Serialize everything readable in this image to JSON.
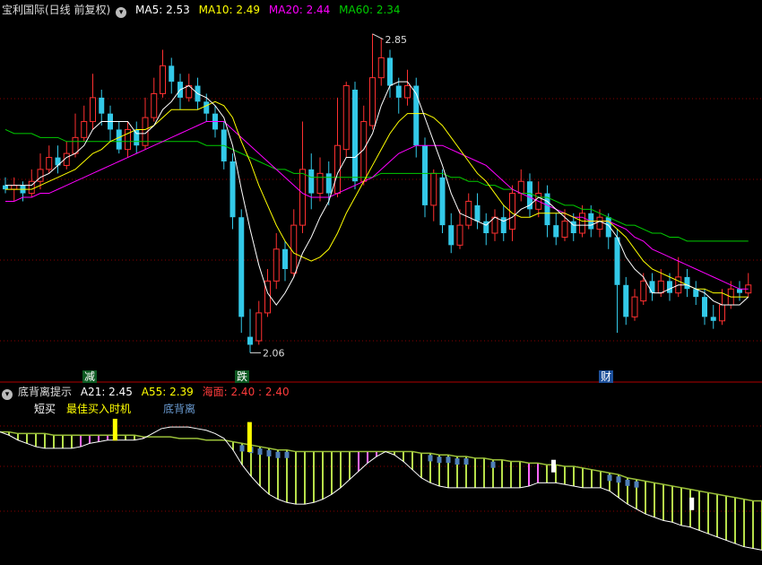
{
  "main_header": {
    "title": "宝利国际(日线 前复权)",
    "ma": [
      {
        "label": "MA5:",
        "value": "2.53",
        "color": "#ffffff"
      },
      {
        "label": "MA10:",
        "value": "2.49",
        "color": "#ffff00"
      },
      {
        "label": "MA20:",
        "value": "2.44",
        "color": "#ff00ff"
      },
      {
        "label": "MA60:",
        "value": "2.34",
        "color": "#00ff00"
      }
    ]
  },
  "sub_header": {
    "title": "底背离提示",
    "items": [
      {
        "text": "A21: 2.45",
        "color": "#ffffff"
      },
      {
        "text": "A55: 2.39",
        "color": "#ffff00"
      },
      {
        "text": "海面: 2.40 : 2.40",
        "color": "#ff3b3b"
      }
    ]
  },
  "signal_legend": [
    {
      "text": "短买",
      "color": "#ffffff"
    },
    {
      "text": "最佳买入时机",
      "color": "#ffff00"
    },
    {
      "text": "底背离",
      "color": "#6a9bd1"
    }
  ],
  "event_tags": [
    {
      "text": "减",
      "color": "#2e9e4a"
    },
    {
      "text": "跌",
      "color": "#2e9e4a"
    },
    {
      "text": "财",
      "color": "#3a7bd5"
    }
  ],
  "colors": {
    "up": "#ff3030",
    "down": "#33c9e8",
    "ma5": "#ffffff",
    "ma10": "#ffff00",
    "ma20": "#ff00ff",
    "ma60": "#00cc00",
    "grid": "#8a0000",
    "osc_bar": "#b6df4a",
    "osc_env": "#9abf3a",
    "osc_pink": "#ff66ff",
    "osc_blue": "#4f7fb8"
  },
  "chart_data": {
    "type": "candlestick",
    "ylim": [
      2.0,
      2.9
    ],
    "annotations": {
      "high_label": "2.85",
      "low_label": "2.06"
    },
    "candles": [
      [
        2.48,
        2.47,
        2.5,
        2.46
      ],
      [
        2.47,
        2.48,
        2.5,
        2.44
      ],
      [
        2.48,
        2.46,
        2.49,
        2.44
      ],
      [
        2.46,
        2.49,
        2.52,
        2.45
      ],
      [
        2.49,
        2.52,
        2.56,
        2.47
      ],
      [
        2.52,
        2.55,
        2.58,
        2.51
      ],
      [
        2.55,
        2.53,
        2.58,
        2.51
      ],
      [
        2.53,
        2.56,
        2.59,
        2.52
      ],
      [
        2.56,
        2.6,
        2.66,
        2.55
      ],
      [
        2.6,
        2.64,
        2.68,
        2.59
      ],
      [
        2.64,
        2.7,
        2.76,
        2.62
      ],
      [
        2.7,
        2.66,
        2.72,
        2.63
      ],
      [
        2.66,
        2.62,
        2.68,
        2.59
      ],
      [
        2.62,
        2.57,
        2.64,
        2.56
      ],
      [
        2.57,
        2.62,
        2.64,
        2.55
      ],
      [
        2.62,
        2.58,
        2.64,
        2.56
      ],
      [
        2.58,
        2.65,
        2.7,
        2.57
      ],
      [
        2.65,
        2.71,
        2.75,
        2.64
      ],
      [
        2.71,
        2.78,
        2.82,
        2.7
      ],
      [
        2.78,
        2.74,
        2.8,
        2.71
      ],
      [
        2.74,
        2.7,
        2.76,
        2.67
      ],
      [
        2.7,
        2.73,
        2.76,
        2.69
      ],
      [
        2.73,
        2.69,
        2.75,
        2.67
      ],
      [
        2.69,
        2.66,
        2.71,
        2.64
      ],
      [
        2.66,
        2.62,
        2.68,
        2.6
      ],
      [
        2.62,
        2.54,
        2.64,
        2.52
      ],
      [
        2.54,
        2.4,
        2.56,
        2.37
      ],
      [
        2.4,
        2.15,
        2.42,
        2.11
      ],
      [
        2.1,
        2.08,
        2.17,
        2.06
      ],
      [
        2.09,
        2.16,
        2.19,
        2.08
      ],
      [
        2.16,
        2.24,
        2.27,
        2.15
      ],
      [
        2.24,
        2.32,
        2.36,
        2.22
      ],
      [
        2.32,
        2.27,
        2.34,
        2.24
      ],
      [
        2.26,
        2.38,
        2.42,
        2.25
      ],
      [
        2.38,
        2.52,
        2.64,
        2.36
      ],
      [
        2.52,
        2.46,
        2.56,
        2.42
      ],
      [
        2.46,
        2.51,
        2.55,
        2.44
      ],
      [
        2.51,
        2.46,
        2.54,
        2.43
      ],
      [
        2.46,
        2.58,
        2.7,
        2.45
      ],
      [
        2.57,
        2.73,
        2.74,
        2.55
      ],
      [
        2.72,
        2.49,
        2.74,
        2.47
      ],
      [
        2.49,
        2.64,
        2.68,
        2.48
      ],
      [
        2.63,
        2.75,
        2.86,
        2.62
      ],
      [
        2.75,
        2.8,
        2.85,
        2.73
      ],
      [
        2.8,
        2.73,
        2.82,
        2.7
      ],
      [
        2.73,
        2.7,
        2.75,
        2.66
      ],
      [
        2.7,
        2.73,
        2.77,
        2.68
      ],
      [
        2.73,
        2.58,
        2.75,
        2.55
      ],
      [
        2.58,
        2.43,
        2.6,
        2.4
      ],
      [
        2.43,
        2.51,
        2.52,
        2.39
      ],
      [
        2.5,
        2.38,
        2.52,
        2.36
      ],
      [
        2.38,
        2.33,
        2.41,
        2.31
      ],
      [
        2.33,
        2.38,
        2.42,
        2.32
      ],
      [
        2.38,
        2.44,
        2.46,
        2.37
      ],
      [
        2.43,
        2.39,
        2.46,
        2.37
      ],
      [
        2.39,
        2.36,
        2.41,
        2.33
      ],
      [
        2.36,
        2.4,
        2.42,
        2.34
      ],
      [
        2.4,
        2.36,
        2.43,
        2.34
      ],
      [
        2.37,
        2.46,
        2.48,
        2.34
      ],
      [
        2.46,
        2.49,
        2.52,
        2.44
      ],
      [
        2.49,
        2.42,
        2.51,
        2.4
      ],
      [
        2.42,
        2.46,
        2.49,
        2.4
      ],
      [
        2.46,
        2.38,
        2.48,
        2.35
      ],
      [
        2.38,
        2.35,
        2.41,
        2.33
      ],
      [
        2.35,
        2.39,
        2.42,
        2.34
      ],
      [
        2.39,
        2.36,
        2.41,
        2.34
      ],
      [
        2.36,
        2.41,
        2.43,
        2.35
      ],
      [
        2.41,
        2.37,
        2.43,
        2.35
      ],
      [
        2.37,
        2.4,
        2.42,
        2.35
      ],
      [
        2.4,
        2.35,
        2.41,
        2.32
      ],
      [
        2.35,
        2.23,
        2.37,
        2.11
      ],
      [
        2.23,
        2.15,
        2.25,
        2.13
      ],
      [
        2.15,
        2.2,
        2.22,
        2.14
      ],
      [
        2.19,
        2.24,
        2.26,
        2.18
      ],
      [
        2.24,
        2.21,
        2.26,
        2.19
      ],
      [
        2.21,
        2.24,
        2.27,
        2.2
      ],
      [
        2.24,
        2.21,
        2.26,
        2.19
      ],
      [
        2.21,
        2.25,
        2.3,
        2.2
      ],
      [
        2.25,
        2.22,
        2.27,
        2.2
      ],
      [
        2.22,
        2.2,
        2.24,
        2.18
      ],
      [
        2.2,
        2.15,
        2.22,
        2.13
      ],
      [
        2.15,
        2.14,
        2.18,
        2.12
      ],
      [
        2.14,
        2.18,
        2.22,
        2.13
      ],
      [
        2.18,
        2.22,
        2.24,
        2.17
      ],
      [
        2.22,
        2.21,
        2.24,
        2.19
      ],
      [
        2.21,
        2.23,
        2.26,
        2.2
      ]
    ],
    "ma": {
      "ma5": [
        2.48,
        2.48,
        2.48,
        2.48,
        2.5,
        2.51,
        2.53,
        2.55,
        2.56,
        2.58,
        2.62,
        2.64,
        2.64,
        2.64,
        2.64,
        2.61,
        2.61,
        2.63,
        2.67,
        2.69,
        2.72,
        2.73,
        2.71,
        2.7,
        2.68,
        2.65,
        2.58,
        2.47,
        2.37,
        2.28,
        2.21,
        2.18,
        2.21,
        2.25,
        2.31,
        2.35,
        2.4,
        2.44,
        2.51,
        2.55,
        2.55,
        2.57,
        2.61,
        2.68,
        2.73,
        2.74,
        2.74,
        2.71,
        2.65,
        2.59,
        2.53,
        2.46,
        2.41,
        2.4,
        2.39,
        2.38,
        2.4,
        2.39,
        2.4,
        2.42,
        2.43,
        2.45,
        2.44,
        2.42,
        2.4,
        2.38,
        2.38,
        2.38,
        2.39,
        2.38,
        2.35,
        2.3,
        2.27,
        2.25,
        2.21,
        2.21,
        2.22,
        2.23,
        2.23,
        2.22,
        2.21,
        2.19,
        2.18,
        2.18,
        2.18,
        2.2
      ],
      "ma10": [
        2.47,
        2.47,
        2.47,
        2.47,
        2.48,
        2.49,
        2.5,
        2.51,
        2.52,
        2.54,
        2.56,
        2.57,
        2.59,
        2.6,
        2.61,
        2.62,
        2.62,
        2.63,
        2.65,
        2.67,
        2.67,
        2.67,
        2.67,
        2.68,
        2.69,
        2.68,
        2.65,
        2.59,
        2.54,
        2.48,
        2.43,
        2.38,
        2.34,
        2.31,
        2.3,
        2.29,
        2.3,
        2.32,
        2.36,
        2.41,
        2.45,
        2.49,
        2.53,
        2.57,
        2.61,
        2.64,
        2.66,
        2.66,
        2.66,
        2.65,
        2.63,
        2.6,
        2.57,
        2.54,
        2.51,
        2.49,
        2.46,
        2.43,
        2.41,
        2.4,
        2.4,
        2.41,
        2.41,
        2.41,
        2.41,
        2.4,
        2.39,
        2.39,
        2.39,
        2.39,
        2.37,
        2.35,
        2.32,
        2.29,
        2.27,
        2.26,
        2.25,
        2.24,
        2.23,
        2.22,
        2.22,
        2.21,
        2.21,
        2.2,
        2.2,
        2.2
      ],
      "ma20": [
        2.44,
        2.44,
        2.45,
        2.45,
        2.46,
        2.46,
        2.47,
        2.48,
        2.49,
        2.5,
        2.51,
        2.52,
        2.53,
        2.54,
        2.55,
        2.56,
        2.57,
        2.58,
        2.59,
        2.6,
        2.61,
        2.62,
        2.63,
        2.64,
        2.64,
        2.64,
        2.62,
        2.6,
        2.58,
        2.56,
        2.54,
        2.52,
        2.5,
        2.48,
        2.46,
        2.45,
        2.45,
        2.45,
        2.46,
        2.47,
        2.48,
        2.49,
        2.5,
        2.52,
        2.54,
        2.56,
        2.57,
        2.58,
        2.58,
        2.58,
        2.58,
        2.57,
        2.56,
        2.55,
        2.54,
        2.53,
        2.51,
        2.49,
        2.47,
        2.46,
        2.45,
        2.44,
        2.43,
        2.42,
        2.41,
        2.4,
        2.4,
        2.39,
        2.39,
        2.39,
        2.38,
        2.37,
        2.35,
        2.34,
        2.32,
        2.31,
        2.3,
        2.29,
        2.28,
        2.27,
        2.26,
        2.25,
        2.24,
        2.23,
        2.22,
        2.22
      ],
      "ma60": [
        2.62,
        2.61,
        2.61,
        2.61,
        2.6,
        2.6,
        2.6,
        2.59,
        2.59,
        2.59,
        2.59,
        2.59,
        2.59,
        2.59,
        2.59,
        2.59,
        2.59,
        2.59,
        2.59,
        2.59,
        2.59,
        2.59,
        2.59,
        2.58,
        2.58,
        2.58,
        2.57,
        2.56,
        2.55,
        2.54,
        2.53,
        2.52,
        2.52,
        2.51,
        2.51,
        2.5,
        2.5,
        2.5,
        2.5,
        2.5,
        2.5,
        2.5,
        2.5,
        2.51,
        2.51,
        2.51,
        2.51,
        2.51,
        2.51,
        2.51,
        2.51,
        2.5,
        2.5,
        2.49,
        2.49,
        2.48,
        2.48,
        2.47,
        2.47,
        2.46,
        2.46,
        2.45,
        2.45,
        2.44,
        2.43,
        2.43,
        2.42,
        2.42,
        2.41,
        2.4,
        2.39,
        2.38,
        2.38,
        2.37,
        2.36,
        2.36,
        2.35,
        2.35,
        2.34,
        2.34,
        2.34,
        2.34,
        2.34,
        2.34,
        2.34,
        2.34
      ]
    },
    "oscillator": {
      "ylim": [
        0,
        10
      ],
      "env_upper": [
        8.0,
        8.0,
        7.9,
        7.9,
        7.9,
        7.9,
        7.8,
        7.8,
        7.8,
        7.8,
        7.8,
        7.8,
        7.8,
        7.8,
        7.8,
        7.8,
        7.7,
        7.7,
        7.7,
        7.7,
        7.6,
        7.6,
        7.6,
        7.5,
        7.5,
        7.5,
        7.4,
        7.3,
        7.2,
        7.1,
        7.0,
        6.9,
        6.9,
        6.8,
        6.8,
        6.8,
        6.8,
        6.8,
        6.8,
        6.8,
        6.8,
        6.8,
        6.8,
        6.8,
        6.8,
        6.8,
        6.8,
        6.7,
        6.7,
        6.6,
        6.6,
        6.5,
        6.5,
        6.4,
        6.4,
        6.3,
        6.3,
        6.2,
        6.2,
        6.1,
        6.1,
        6.0,
        6.0,
        5.9,
        5.9,
        5.8,
        5.7,
        5.6,
        5.5,
        5.4,
        5.2,
        5.1,
        5.0,
        4.9,
        4.8,
        4.7,
        4.6,
        4.5,
        4.4,
        4.3,
        4.2,
        4.1,
        4.0,
        3.9,
        3.8,
        3.8
      ],
      "osc": [
        8.0,
        7.8,
        7.5,
        7.3,
        7.1,
        7.0,
        7.0,
        7.0,
        7.0,
        7.1,
        7.3,
        7.4,
        7.5,
        7.5,
        7.5,
        7.5,
        7.6,
        7.9,
        8.2,
        8.3,
        8.3,
        8.3,
        8.2,
        8.1,
        7.9,
        7.6,
        6.9,
        6.0,
        5.3,
        4.7,
        4.2,
        3.9,
        3.7,
        3.6,
        3.6,
        3.7,
        3.9,
        4.2,
        4.6,
        5.1,
        5.6,
        6.1,
        6.5,
        6.8,
        6.6,
        6.2,
        5.7,
        5.2,
        4.9,
        4.7,
        4.6,
        4.6,
        4.6,
        4.6,
        4.6,
        4.6,
        4.6,
        4.6,
        4.6,
        4.7,
        4.9,
        4.9,
        4.9,
        4.8,
        4.7,
        4.6,
        4.6,
        4.6,
        4.4,
        4.0,
        3.6,
        3.3,
        3.0,
        2.8,
        2.6,
        2.5,
        2.3,
        2.2,
        2.0,
        1.8,
        1.6,
        1.4,
        1.2,
        1.0,
        0.9,
        0.8
      ],
      "yellow_signals": [
        {
          "index": 23,
          "value": 8.8
        },
        {
          "index": 50,
          "value": 8.6
        }
      ],
      "white_signals": [
        {
          "index": 112,
          "value": 6.3
        },
        {
          "index": 140,
          "value": 4.0
        }
      ]
    }
  }
}
